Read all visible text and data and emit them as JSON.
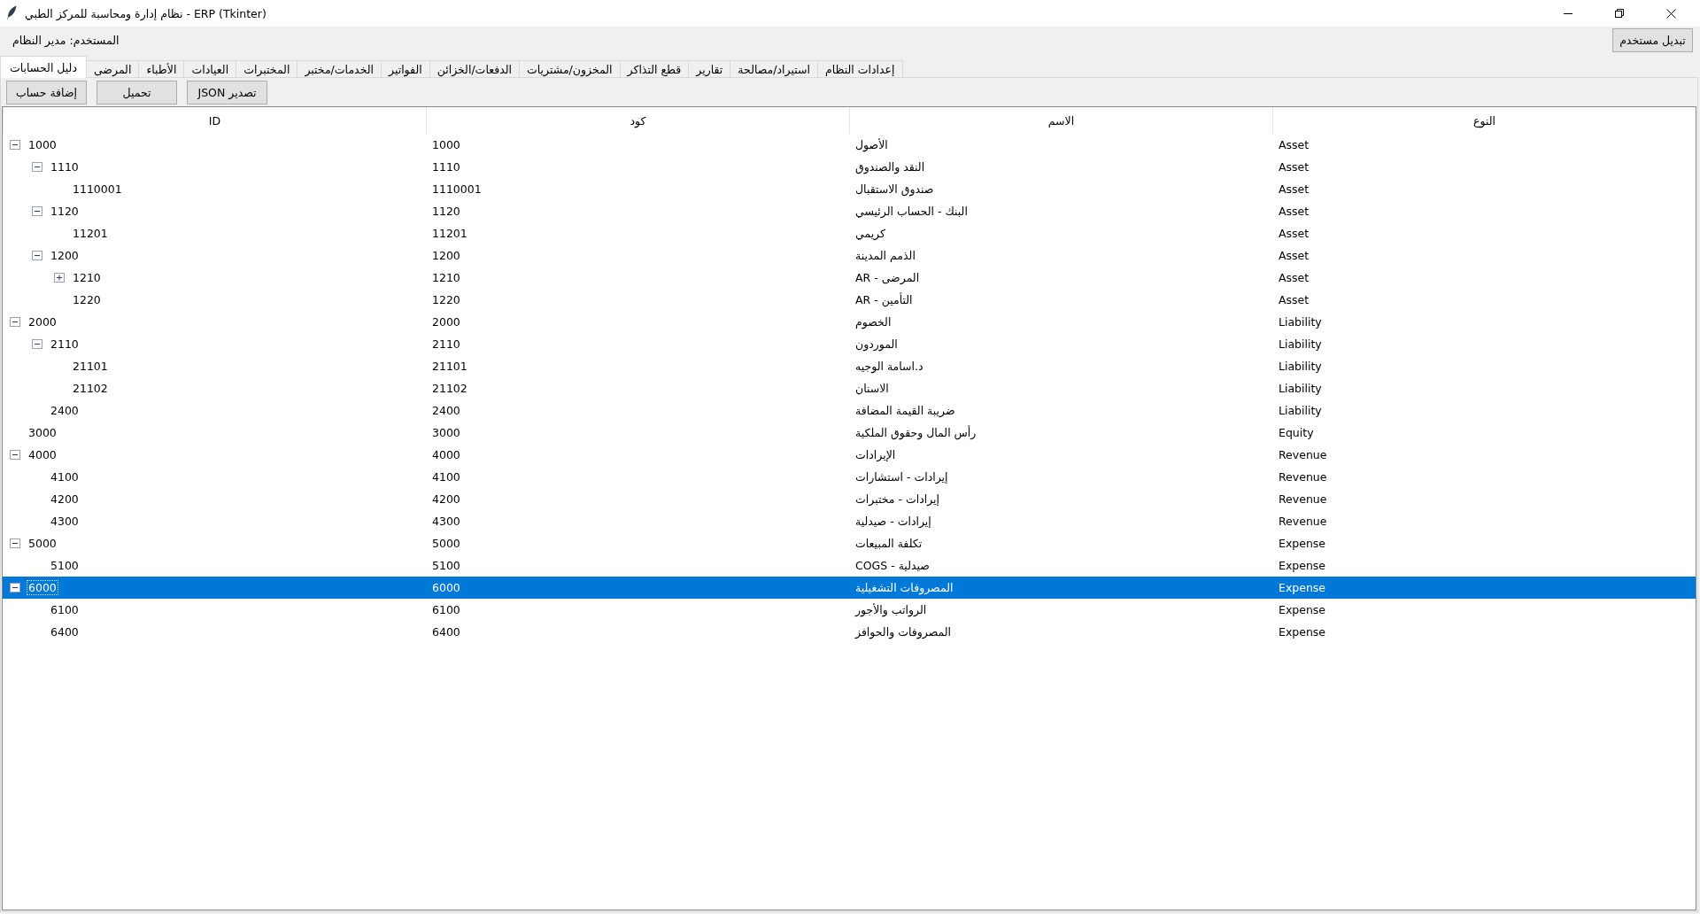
{
  "window": {
    "title": "نظام إدارة ومحاسبة للمركز الطبي - ERP (Tkinter)"
  },
  "user_bar": {
    "user_label": "المستخدم: مدير النظام",
    "switch_user_button": "تبديل مستخدم"
  },
  "tabs": [
    {
      "label": "إعدادات النظام",
      "selected": false
    },
    {
      "label": "استيراد/مصالحة",
      "selected": false
    },
    {
      "label": "تقارير",
      "selected": false
    },
    {
      "label": "قطع التذاكر",
      "selected": false
    },
    {
      "label": "المخزون/مشتريات",
      "selected": false
    },
    {
      "label": "الدفعات/الخزائن",
      "selected": false
    },
    {
      "label": "الفواتير",
      "selected": false
    },
    {
      "label": "الخدمات/مختبر",
      "selected": false
    },
    {
      "label": "المختبرات",
      "selected": false
    },
    {
      "label": "العيادات",
      "selected": false
    },
    {
      "label": "الأطباء",
      "selected": false
    },
    {
      "label": "المرضى",
      "selected": false
    },
    {
      "label": "دليل الحسابات",
      "selected": true
    }
  ],
  "toolbar": {
    "buttons": [
      "JSON تصدير",
      "تحميل",
      "إضافة حساب"
    ]
  },
  "tree": {
    "columns": [
      "النوع",
      "الاسم",
      "كود",
      "ID"
    ],
    "rows": [
      {
        "kind": "group",
        "expanded": true,
        "selected": false,
        "id": "1000",
        "code": "1000",
        "name": "الأصول",
        "account_type": "Asset",
        "children": [
          {
            "kind": "group",
            "expanded": true,
            "selected": false,
            "id": "1110",
            "code": "1110",
            "name": "النقد والصندوق",
            "account_type": "Asset",
            "children": [
              {
                "kind": "leaf",
                "selected": false,
                "id": "1110001",
                "code": "1110001",
                "name": "صندوق الاستقبال",
                "account_type": "Asset"
              }
            ]
          },
          {
            "kind": "group",
            "expanded": true,
            "selected": false,
            "id": "1120",
            "code": "1120",
            "name": "البنك - الحساب الرئيسي",
            "account_type": "Asset",
            "children": [
              {
                "kind": "leaf",
                "selected": false,
                "id": "11201",
                "code": "11201",
                "name": "كريمي",
                "account_type": "Asset"
              }
            ]
          },
          {
            "kind": "group",
            "expanded": true,
            "selected": false,
            "id": "1200",
            "code": "1200",
            "name": "الذمم المدينة",
            "account_type": "Asset",
            "children": [
              {
                "kind": "group",
                "expanded": false,
                "selected": false,
                "id": "1210",
                "code": "1210",
                "name": "AR - المرضى",
                "account_type": "Asset"
              },
              {
                "kind": "leaf",
                "selected": false,
                "id": "1220",
                "code": "1220",
                "name": "AR - التأمين",
                "account_type": "Asset"
              }
            ]
          }
        ]
      },
      {
        "kind": "group",
        "expanded": true,
        "selected": false,
        "id": "2000",
        "code": "2000",
        "name": "الخصوم",
        "account_type": "Liability",
        "children": [
          {
            "kind": "group",
            "expanded": true,
            "selected": false,
            "id": "2110",
            "code": "2110",
            "name": "الموردون",
            "account_type": "Liability",
            "children": [
              {
                "kind": "leaf",
                "selected": false,
                "id": "21101",
                "code": "21101",
                "name": "د.اسامة الوجيه",
                "account_type": "Liability"
              },
              {
                "kind": "leaf",
                "selected": false,
                "id": "21102",
                "code": "21102",
                "name": "الاسنان",
                "account_type": "Liability"
              }
            ]
          },
          {
            "kind": "leaf",
            "selected": false,
            "id": "2400",
            "code": "2400",
            "name": "ضريبة القيمة المضافة",
            "account_type": "Liability"
          }
        ]
      },
      {
        "kind": "leaf",
        "selected": false,
        "id": "3000",
        "code": "3000",
        "name": "رأس المال وحقوق الملكية",
        "account_type": "Equity"
      },
      {
        "kind": "group",
        "expanded": true,
        "selected": false,
        "id": "4000",
        "code": "4000",
        "name": "الإيرادات",
        "account_type": "Revenue",
        "children": [
          {
            "kind": "leaf",
            "selected": false,
            "id": "4100",
            "code": "4100",
            "name": "إيرادات - استشارات",
            "account_type": "Revenue"
          },
          {
            "kind": "leaf",
            "selected": false,
            "id": "4200",
            "code": "4200",
            "name": "إيرادات - مختبرات",
            "account_type": "Revenue"
          },
          {
            "kind": "leaf",
            "selected": false,
            "id": "4300",
            "code": "4300",
            "name": "إيرادات - صيدلية",
            "account_type": "Revenue"
          }
        ]
      },
      {
        "kind": "group",
        "expanded": true,
        "selected": false,
        "id": "5000",
        "code": "5000",
        "name": "تكلفة المبيعات",
        "account_type": "Expense",
        "children": [
          {
            "kind": "leaf",
            "selected": false,
            "id": "5100",
            "code": "5100",
            "name": "COGS - صيدلية",
            "account_type": "Expense"
          }
        ]
      },
      {
        "kind": "group",
        "expanded": true,
        "selected": true,
        "id": "6000",
        "code": "6000",
        "name": "المصروفات التشغيلية",
        "account_type": "Expense",
        "children": [
          {
            "kind": "leaf",
            "selected": false,
            "id": "6100",
            "code": "6100",
            "name": "الرواتب والأجور",
            "account_type": "Expense"
          },
          {
            "kind": "leaf",
            "selected": false,
            "id": "6400",
            "code": "6400",
            "name": "المصروفات والحوافز",
            "account_type": "Expense"
          }
        ]
      }
    ]
  }
}
